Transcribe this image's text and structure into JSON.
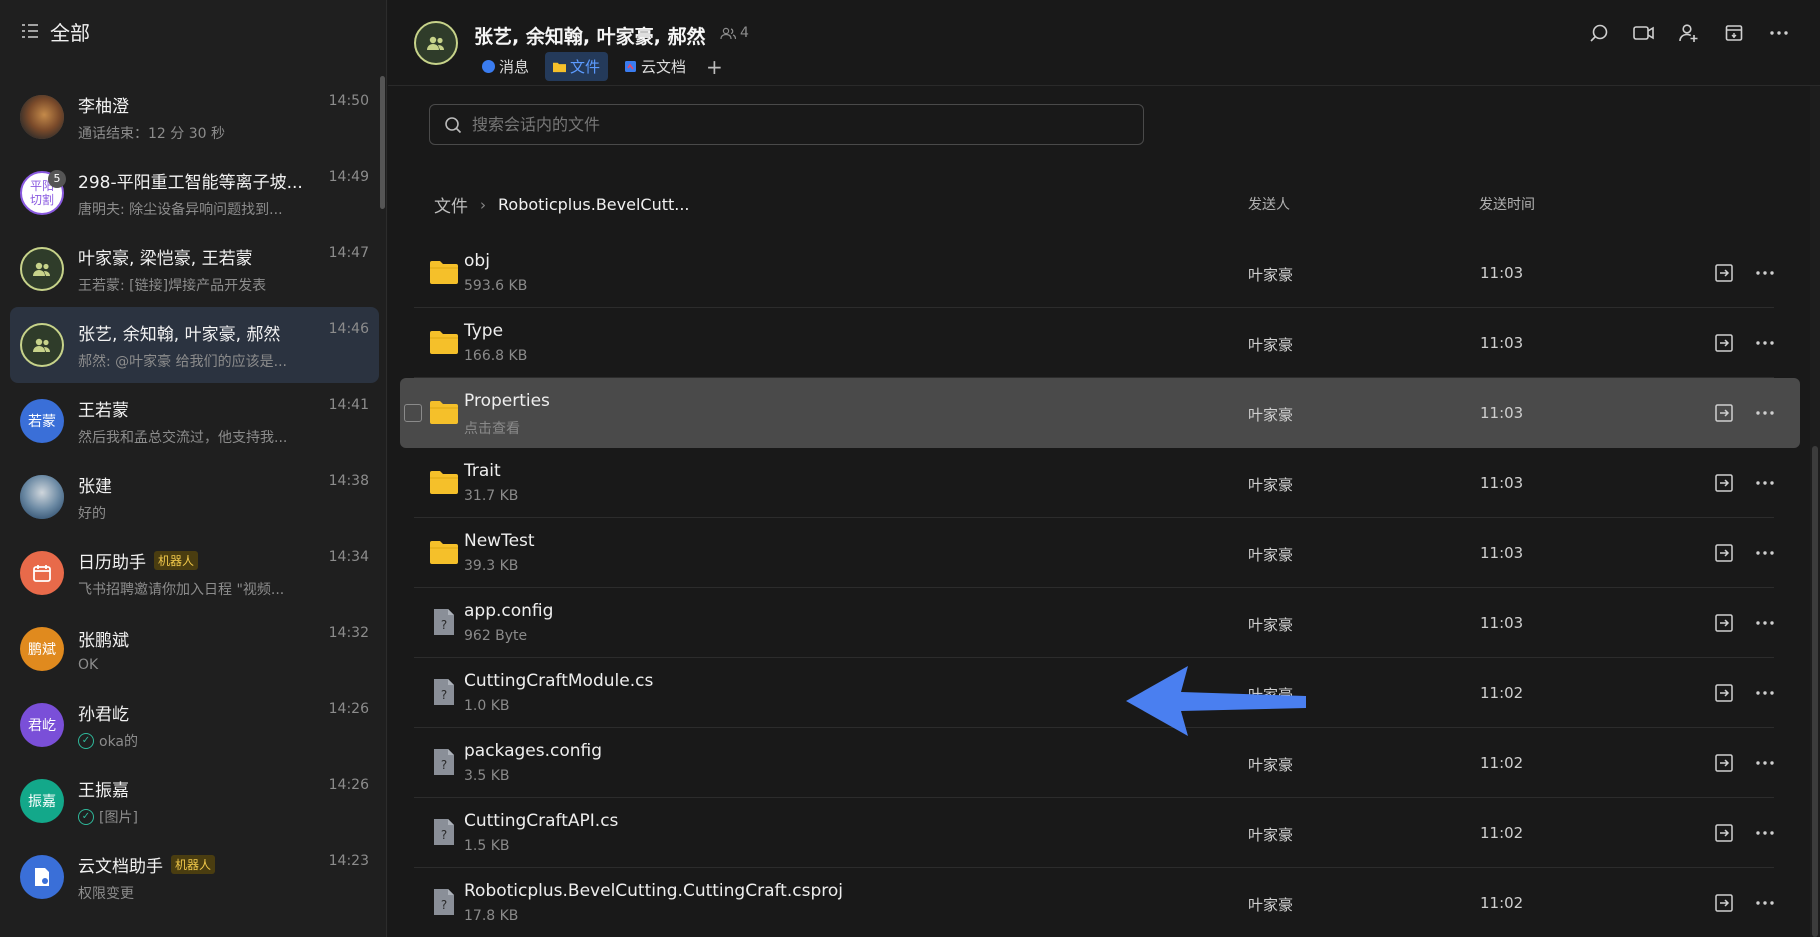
{
  "sidebar": {
    "title": "全部",
    "chats": [
      {
        "name": "李柚澄",
        "message": "通话结束：12 分 30 秒",
        "time": "14:50",
        "avatar_text": "",
        "avatar_color": "#6b5a4a"
      },
      {
        "name": "298-平阳重工智能等离子坡...",
        "message": "唐明夫: 除尘设备异响问题找到...",
        "time": "14:49",
        "avatar_text": "平阳切割",
        "avatar_color": "#ffffff",
        "unread": "5"
      },
      {
        "name": "叶家豪, 梁恺豪, 王若蒙",
        "message": "王若蒙: [链接]焊接产品开发表",
        "time": "14:47",
        "avatar_text": "",
        "avatar_color": "#2f3c2a"
      },
      {
        "name": "张艺, 余知翰, 叶家豪, 郝然",
        "message": "郝然: @叶家豪 给我们的应该是...",
        "time": "14:46",
        "avatar_text": "",
        "avatar_color": "#2f3c2a"
      },
      {
        "name": "王若蒙",
        "message": "然后我和孟总交流过，他支持我...",
        "time": "14:41",
        "avatar_text": "若蒙",
        "avatar_color": "#3a6fd8"
      },
      {
        "name": "张建",
        "message": "好的",
        "time": "14:38",
        "avatar_text": "",
        "avatar_color": "#4f6e8a"
      },
      {
        "name": "日历助手",
        "message": "飞书招聘邀请你加入日程 \"视频...",
        "time": "14:34",
        "avatar_text": "",
        "avatar_color": "#e86a4a",
        "tag": "机器人"
      },
      {
        "name": "张鹏斌",
        "message": "OK",
        "time": "14:32",
        "avatar_text": "鹏斌",
        "avatar_color": "#e08a1e"
      },
      {
        "name": "孙君屹",
        "message": "oka的",
        "time": "14:26",
        "avatar_text": "君屹",
        "avatar_color": "#7a4fd8",
        "checked": true
      },
      {
        "name": "王振嘉",
        "message": "[图片]",
        "time": "14:26",
        "avatar_text": "振嘉",
        "avatar_color": "#13a88a",
        "checked": true
      },
      {
        "name": "云文档助手",
        "message": "权限变更",
        "time": "14:23",
        "avatar_text": "",
        "avatar_color": "#3a6fd8",
        "tag": "机器人"
      }
    ]
  },
  "header": {
    "title": "张艺, 余知翰, 叶家豪, 郝然",
    "member_count": "4",
    "tabs": [
      {
        "label": "消息",
        "active": false,
        "icon": "message-icon"
      },
      {
        "label": "文件",
        "active": true,
        "icon": "folder-icon"
      },
      {
        "label": "云文档",
        "active": false,
        "icon": "doc-icon"
      }
    ],
    "actions": [
      "search-icon",
      "video-call-icon",
      "add-member-icon",
      "pin-icon",
      "more-icon"
    ]
  },
  "search": {
    "placeholder": "搜索会话内的文件"
  },
  "breadcrumb": {
    "root": "文件",
    "current": "Roboticplus.BevelCutt..."
  },
  "columns": {
    "sender": "发送人",
    "time": "发送时间"
  },
  "files": [
    {
      "name": "obj",
      "size": "593.6 KB",
      "sender": "叶家豪",
      "time": "11:03",
      "type": "folder"
    },
    {
      "name": "Type",
      "size": "166.8 KB",
      "sender": "叶家豪",
      "time": "11:03",
      "type": "folder"
    },
    {
      "name": "Properties",
      "size": "点击查看",
      "sender": "叶家豪",
      "time": "11:03",
      "type": "folder",
      "hover": true
    },
    {
      "name": "Trait",
      "size": "31.7 KB",
      "sender": "叶家豪",
      "time": "11:03",
      "type": "folder"
    },
    {
      "name": "NewTest",
      "size": "39.3 KB",
      "sender": "叶家豪",
      "time": "11:03",
      "type": "folder"
    },
    {
      "name": "app.config",
      "size": "962 Byte",
      "sender": "叶家豪",
      "time": "11:03",
      "type": "unknown"
    },
    {
      "name": "CuttingCraftModule.cs",
      "size": "1.0 KB",
      "sender": "叶家豪",
      "time": "11:02",
      "type": "unknown"
    },
    {
      "name": "packages.config",
      "size": "3.5 KB",
      "sender": "叶家豪",
      "time": "11:02",
      "type": "unknown"
    },
    {
      "name": "CuttingCraftAPI.cs",
      "size": "1.5 KB",
      "sender": "叶家豪",
      "time": "11:02",
      "type": "unknown"
    },
    {
      "name": "Roboticplus.BevelCutting.CuttingCraft.csproj",
      "size": "17.8 KB",
      "sender": "叶家豪",
      "time": "11:02",
      "type": "unknown"
    }
  ],
  "colors": {
    "accent": "#5c9bff",
    "folder": "#f5c02a",
    "arrow": "#4a7ff0"
  }
}
